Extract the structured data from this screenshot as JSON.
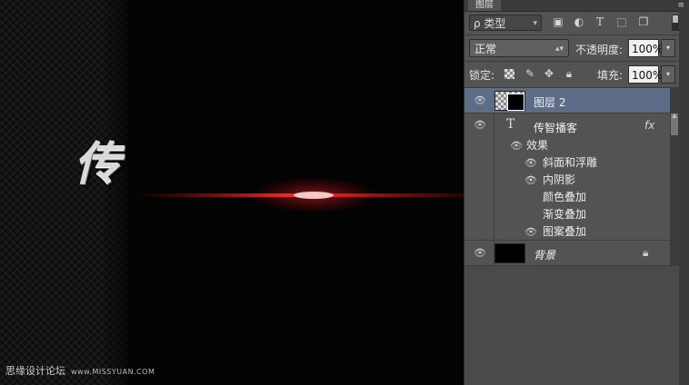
{
  "canvas": {
    "title_char": "传",
    "watermark": {
      "text": "思缘设计论坛",
      "site": "www.MISSYUAN.COM"
    },
    "flare_color": "#ff2020"
  },
  "panel": {
    "tab": "图层",
    "filter": {
      "label": "ρ 类型",
      "icons": [
        "image-filter-icon",
        "adjustment-filter-icon",
        "type-filter-icon",
        "shape-filter-icon",
        "smart-object-filter-icon"
      ]
    },
    "blend_mode": "正常",
    "opacity": {
      "label": "不透明度:",
      "value": "100%"
    },
    "lock": {
      "label": "锁定:",
      "icons": [
        "lock-transparent-icon",
        "lock-paint-icon",
        "lock-move-icon",
        "lock-all-icon"
      ]
    },
    "fill": {
      "label": "填充:",
      "value": "100%"
    },
    "layers": [
      {
        "name": "图层 2",
        "selected": true
      },
      {
        "name": "传智播客",
        "type": "text",
        "fx": "fx"
      },
      {
        "name": "背景",
        "locked": true
      }
    ],
    "effects": {
      "header": "效果",
      "items": [
        "斜面和浮雕",
        "内阴影",
        "颜色叠加",
        "渐变叠加",
        "图案叠加"
      ]
    }
  }
}
